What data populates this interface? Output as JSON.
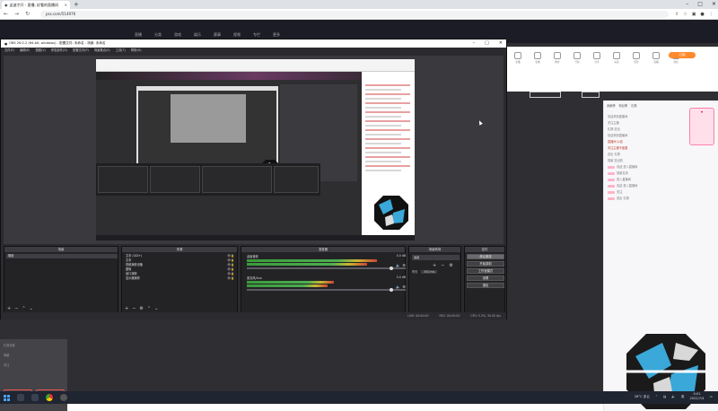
{
  "browser": {
    "tab_title": "这波才开 - 直播, 好看的直播间",
    "url": "pss.com/514976"
  },
  "site": {
    "nav_items": [
      "直播",
      "分类",
      "游戏",
      "娱乐",
      "赛事",
      "视频",
      "专栏",
      "更多"
    ],
    "func_icons": [
      "主播",
      "礼物",
      "粉丝",
      "守护",
      "分享",
      "关注",
      "任务",
      "直播",
      "消息"
    ],
    "subscribe": "订阅",
    "chat_tabs": [
      "贡献榜",
      "粉丝榜",
      "礼物"
    ],
    "chat_messages": [
      "欢迎来到直播间",
      "关注主播",
      "礼物 送出",
      "欢迎来到直播间",
      "直播间 公告",
      "关注主播不迷路",
      "送出 礼物",
      "感谢 送出的",
      "欢迎 进入直播间",
      "感谢支持",
      "进入直播间",
      "欢迎 进入直播间",
      "关注",
      "送出 礼物"
    ],
    "left_rows": [
      "礼物设置",
      "弹幕",
      "关注"
    ],
    "left_buttons": [
      "关注",
      "订阅"
    ]
  },
  "obs": {
    "title": "OBS 26.0.2 (64-bit, windows) - 配置文件: 未命名 - 场景: 未命名",
    "menu": [
      "文件(F)",
      "编辑(E)",
      "视图(V)",
      "停靠部件(D)",
      "配置文件(P)",
      "场景集合(S)",
      "工具(T)",
      "帮助(H)"
    ],
    "scenes_header": "场景",
    "scenes": [
      "场景"
    ],
    "sources_header": "来源",
    "sources": [
      "文本 (GDI+)",
      "文本",
      "视频捕获设备",
      "图像",
      "窗口捕获",
      "显示器捕获"
    ],
    "mixer_header": "混音器",
    "mixer_tracks": [
      {
        "name": "桌面音频",
        "db": "0.0 dB",
        "level": 0.82
      },
      {
        "name": "麦克风/Aux",
        "db": "0.0 dB",
        "level": 0.55
      }
    ],
    "transitions_header": "场景转场",
    "transition": "淡出",
    "duration_label": "时长",
    "duration_value": "300 ms",
    "controls_header": "控件",
    "controls": [
      "停止推流",
      "开始录制",
      "工作室模式",
      "设置",
      "退出"
    ],
    "status": [
      "LIVE: 00:00:00",
      "REC: 00:00:00",
      "CPU: 5.3%, 30.00 fps"
    ]
  },
  "taskbar": {
    "weather": "28°C 多云",
    "time": "0:01",
    "date": "2022/7/4",
    "lang": "英"
  },
  "colors": {
    "accent": "#ff8a2b",
    "obs_bg": "#2b2b2f",
    "taskbar": "#1f2531"
  }
}
